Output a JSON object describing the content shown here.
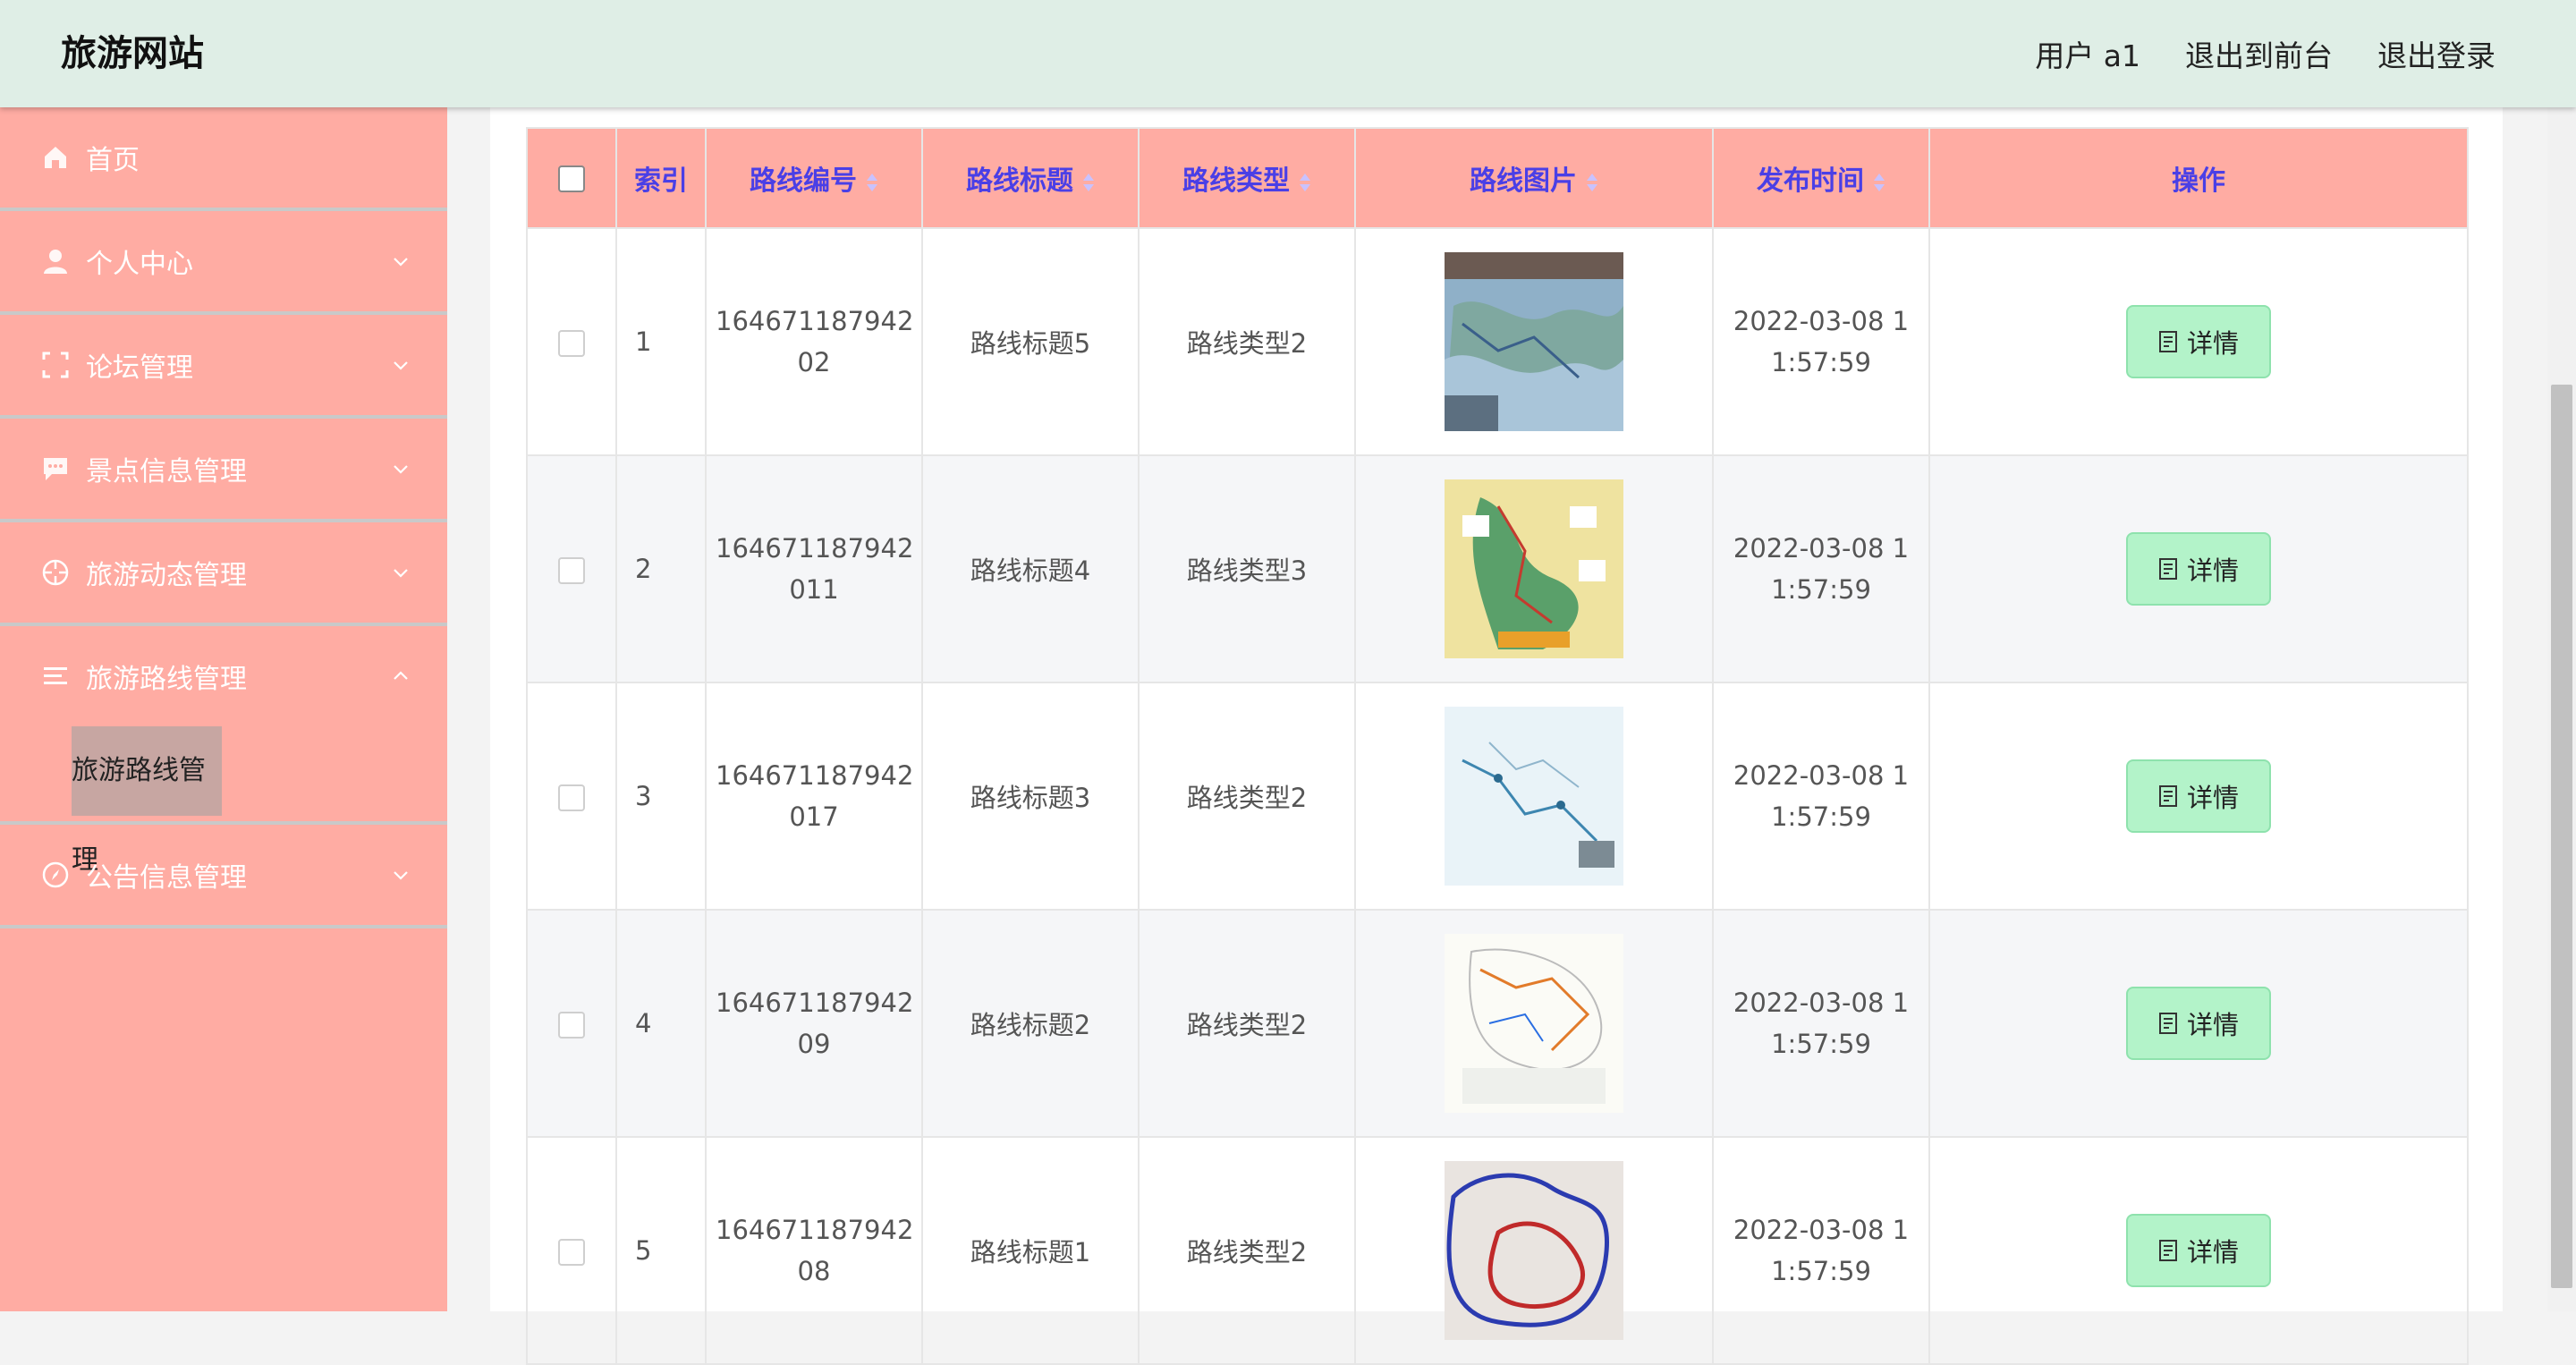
{
  "header": {
    "brand": "旅游网站",
    "user": "用户 a1",
    "to_front": "退出到前台",
    "logout": "退出登录"
  },
  "sidebar": {
    "items": [
      {
        "label": "首页",
        "icon": "home-icon"
      },
      {
        "label": "个人中心",
        "icon": "user-icon"
      },
      {
        "label": "论坛管理",
        "icon": "frame-icon"
      },
      {
        "label": "景点信息管理",
        "icon": "chat-icon"
      },
      {
        "label": "旅游动态管理",
        "icon": "crosshair-icon"
      },
      {
        "label": "旅游路线管理",
        "icon": "list-icon"
      },
      {
        "label": "公告信息管理",
        "icon": "compass-icon"
      }
    ],
    "sub_active": "旅游路线管理"
  },
  "table": {
    "headers": {
      "index": "索引",
      "code": "路线编号",
      "title": "路线标题",
      "type": "路线类型",
      "image": "路线图片",
      "time": "发布时间",
      "action": "操作"
    },
    "detail_label": "详情",
    "rows": [
      {
        "index": "1",
        "code_a": "164671187942",
        "code_b": "02",
        "title": "路线标题5",
        "type": "路线类型2",
        "time_a": "2022-03-08 1",
        "time_b": "1:57:59"
      },
      {
        "index": "2",
        "code_a": "164671187942",
        "code_b": "011",
        "title": "路线标题4",
        "type": "路线类型3",
        "time_a": "2022-03-08 1",
        "time_b": "1:57:59"
      },
      {
        "index": "3",
        "code_a": "164671187942",
        "code_b": "017",
        "title": "路线标题3",
        "type": "路线类型2",
        "time_a": "2022-03-08 1",
        "time_b": "1:57:59"
      },
      {
        "index": "4",
        "code_a": "164671187942",
        "code_b": "09",
        "title": "路线标题2",
        "type": "路线类型2",
        "time_a": "2022-03-08 1",
        "time_b": "1:57:59"
      },
      {
        "index": "5",
        "code_a": "164671187942",
        "code_b": "08",
        "title": "路线标题1",
        "type": "路线类型2",
        "time_a": "2022-03-08 1",
        "time_b": "1:57:59"
      }
    ]
  }
}
